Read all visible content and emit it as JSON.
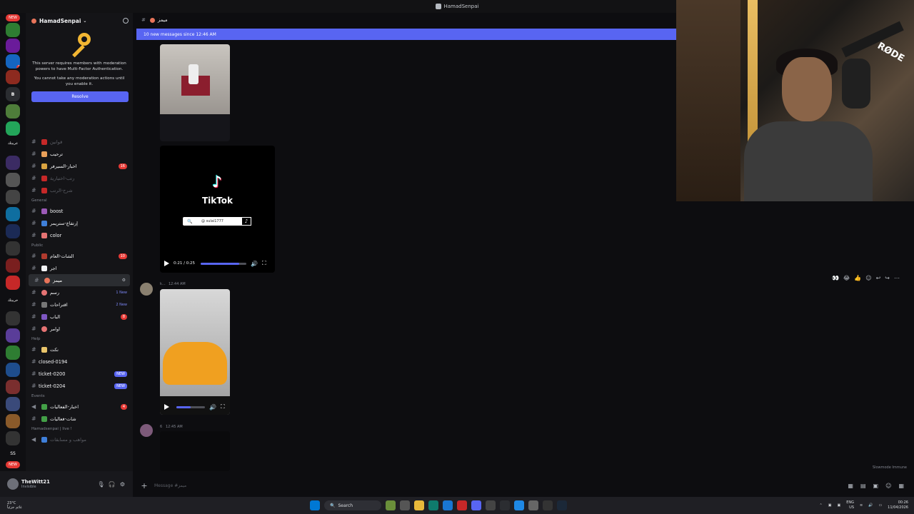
{
  "window": {
    "title": "HamadSenpai"
  },
  "server": {
    "name": "HamadSenpai",
    "mfa_text_1": "This server requires members with moderation powers to have Multi-Factor Authentication.",
    "mfa_text_2": "You cannot take any moderation actions until you enable it.",
    "resolve_label": "Resolve"
  },
  "rail_labels": {
    "new_top": "NEW",
    "letter_b": "B",
    "arabic_label": "عربيتك",
    "arabic_label_2": "خربيتك",
    "ss": "SS",
    "new_bottom": "NEW"
  },
  "categories": {
    "general": "General",
    "public": "Public",
    "help": "Help",
    "events": "Events",
    "live": "Hamadsenpai | live !"
  },
  "channels": {
    "c1": "قوانين",
    "c2": "ترحيب",
    "c3": "اخبار-السيرفر",
    "c3_count": "16",
    "c4": "رتب-اختيارية",
    "c5": "شرح-الرتب",
    "boost": "boost",
    "c7": "إرتفاع-ستريمر",
    "color": "color",
    "c9": "الشات-العام",
    "c9_count": "10",
    "c10": "اجر",
    "c11": "ميمز",
    "c12": "رسم",
    "c12_new": "1 New",
    "c13": "اقتراحات",
    "c13_new": "2 New",
    "c14": "الباب",
    "c14_count": "8",
    "c15": "اوامر",
    "c16": "نكت",
    "closed": "closed-0194",
    "t200": "ticket-0200",
    "t204": "ticket-0204",
    "new_badge": "NEW",
    "c20": "اخبار-الفعاليات",
    "c20_count": "4",
    "c21": "شات-فعاليات",
    "c22": "مواهب و مسابقات"
  },
  "user": {
    "name": "TheWitt21",
    "status": "Invisible"
  },
  "main": {
    "channel_title": "ميمز",
    "new_messages": "10 new messages since 12:46 AM",
    "tiktok_word": "TikTok",
    "tiktok_handle": "@ sulai1777",
    "video1_time": "0:21 / 0:25",
    "msg1_author": "k...",
    "msg1_time": "12:44 AM",
    "msg2_author": "6",
    "msg2_time": "12:45 AM",
    "composer_placeholder": "Message #ميمز",
    "slowmode": "Slowmode Immune",
    "video1_progress": 0.84,
    "video2_progress": 0.5
  },
  "webcam": {
    "mic_brand": "RØDE"
  },
  "taskbar": {
    "weather_temp": "23°C",
    "weather_desc": "غائم جزئياً",
    "search_label": "Search",
    "lang_1": "ENG",
    "lang_2": "US",
    "time": "00:26",
    "date": "11/04/2026"
  },
  "colors": {
    "accent": "#5865f2",
    "danger": "#e53935",
    "bg": "#0d0d10"
  }
}
